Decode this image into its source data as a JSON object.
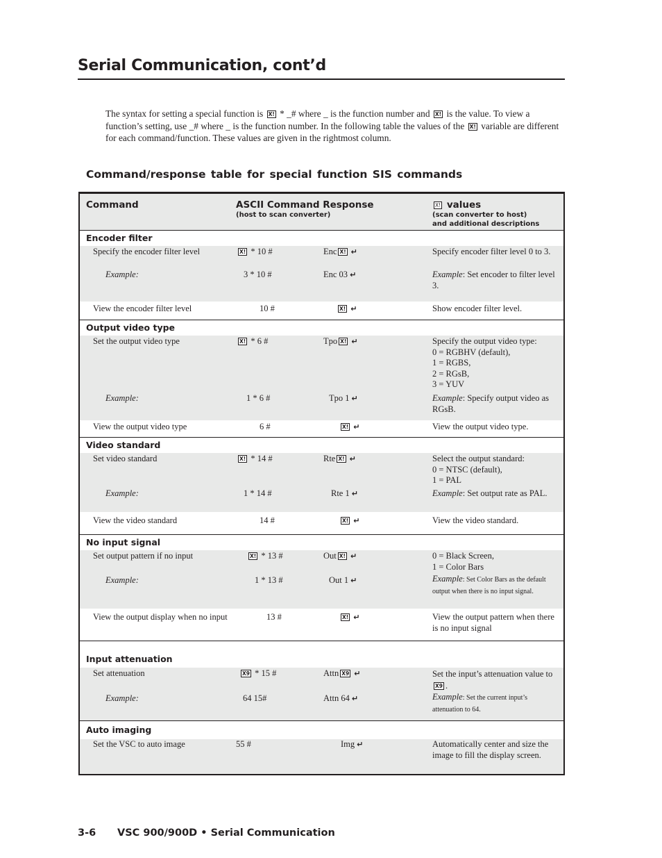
{
  "header": {
    "title": "Serial Communication, cont’d"
  },
  "intro": {
    "part1": "The syntax for setting  a special function is ",
    "part2": " * _#  where  _  is the function number and ",
    "part3": " is the value. To view a function’s setting, use  _#  where  _  is the function number.  In the following table the values of the ",
    "part4": " variable are different for each command/function.  These values are given in the rightmost column."
  },
  "icons": {
    "x1": "X!",
    "x9": "X9",
    "enter": "↵"
  },
  "table": {
    "title": "Command/response table for special function SIS commands",
    "headers": {
      "command": "Command",
      "ascii": "ASCII Command  Response",
      "ascii_sub": "(host to scan converter)",
      "values": "values",
      "values_sub1": "(scan converter to host)",
      "values_sub2": "and additional descriptions"
    },
    "sections": [
      {
        "title": "Encoder filter",
        "rows": [
          {
            "command": "Specify the encoder filter level",
            "ascii": "* 10 #",
            "response": "Enc",
            "desc": "Specify encoder filter level 0 to 3."
          },
          {
            "command": "Example:",
            "ascii": "3 * 10 #",
            "response": "Enc 03",
            "desc_label": "Example",
            "desc": ": Set encoder to filter level 3."
          },
          {
            "command": "View the encoder filter level",
            "ascii": "10 #",
            "response": "",
            "desc": "Show encoder filter level."
          }
        ]
      },
      {
        "title": "Output video type",
        "rows": [
          {
            "command": "Set the output video type",
            "ascii": "* 6 #",
            "response": "Tpo",
            "desc_lines": [
              "Specify the output video type:",
              "0 = RGBHV (default),",
              "1 = RGBS,",
              "2 = RGsB,",
              "3 = YUV"
            ]
          },
          {
            "command": "Example:",
            "ascii": "1 * 6 #",
            "response": "Tpo 1",
            "desc_label": "Example",
            "desc": ": Specify output video as RGsB."
          },
          {
            "command": "View the output video type",
            "ascii": "6 #",
            "response": "",
            "desc": "View the output video type."
          }
        ]
      },
      {
        "title": "Video standard",
        "rows": [
          {
            "command": "Set video standard",
            "ascii": "* 14 #",
            "response": "Rte",
            "desc_lines": [
              "Select the output standard:",
              "0 = NTSC (default),",
              "1 = PAL"
            ]
          },
          {
            "command": "Example:",
            "ascii": "1 * 14 #",
            "response": "Rte 1",
            "desc_label": "Example",
            "desc": ": Set output rate as PAL."
          },
          {
            "command": "View the video standard",
            "ascii": "14 #",
            "response": "",
            "desc": "View the video standard."
          }
        ]
      },
      {
        "title": "No input signal",
        "rows": [
          {
            "command": "Set output pattern if no input",
            "ascii": "* 13 #",
            "response": "Out",
            "desc_lines": [
              "0 = Black Screen,",
              "1 = Color Bars"
            ]
          },
          {
            "command": "Example:",
            "ascii": "1 * 13 #",
            "response": "Out 1",
            "desc_label": "Example",
            "desc": ": Set Color Bars as the default output when there is no input signal."
          },
          {
            "command": "View the output display when no input",
            "ascii": "13 #",
            "response": "",
            "desc": "View the output pattern when there is no input signal"
          }
        ]
      },
      {
        "title": "Input attenuation",
        "rows": [
          {
            "command": "Set attenuation",
            "ascii": "* 15 #",
            "response": "Attn",
            "desc": "Set the input’s attenuation value to",
            "desc_end": "."
          },
          {
            "command": "Example:",
            "ascii": "64 15#",
            "response": "Attn 64",
            "desc_label": "Example",
            "desc": ": Set the current input’s attenuation to 64."
          }
        ]
      },
      {
        "title": "Auto imaging",
        "rows": [
          {
            "command": "Set the VSC to auto image",
            "ascii": "55 #",
            "response": "Img",
            "desc": "Automatically center and size the image to fill the display screen."
          }
        ]
      }
    ]
  },
  "footer": {
    "page": "3-6",
    "text": "VSC 900/900D • Serial Communication"
  }
}
